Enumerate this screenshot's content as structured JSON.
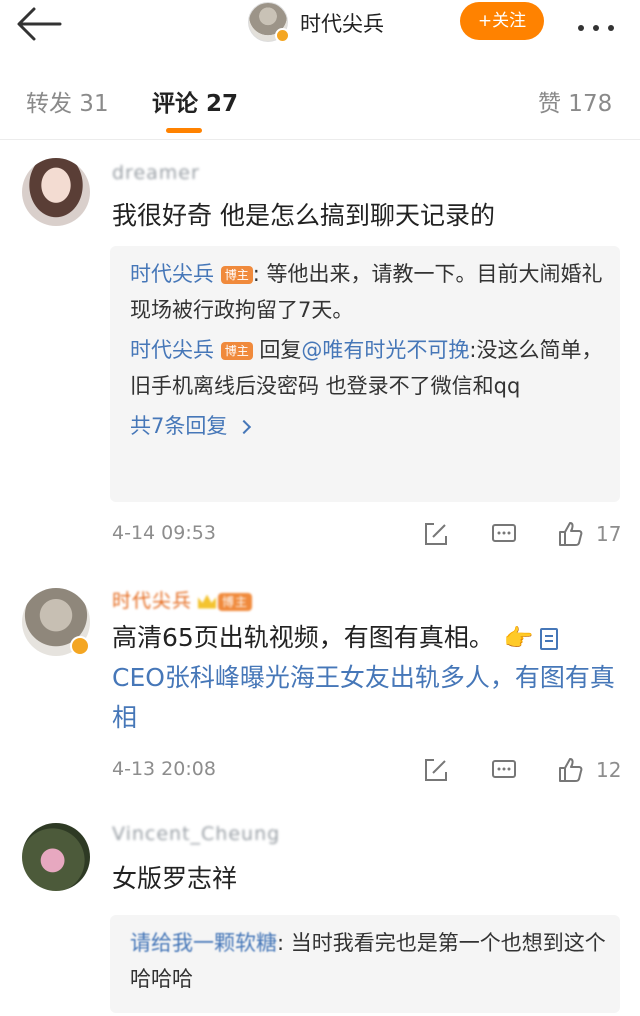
{
  "header": {
    "account_name": "时代尖兵",
    "follow_label": "+关注",
    "colors": {
      "accent": "#ff8200",
      "link": "#4677b8"
    }
  },
  "tabs": [
    {
      "label": "转发 31"
    },
    {
      "label": "评论 27"
    },
    {
      "label": "赞 178"
    }
  ],
  "comments": [
    {
      "user": "dreamer",
      "text": "我很好奇  他是怎么搞到聊天记录的",
      "replies": [
        {
          "name": "时代尖兵",
          "badge": "博主",
          "prefix": "",
          "mention": "",
          "text": ": 等他出来，请教一下。目前大闹婚礼现场被行政拘留了7天。"
        },
        {
          "name": "时代尖兵",
          "badge": "博主",
          "prefix": " 回复",
          "mention": "@唯有时光不可挽",
          "text": ":没这么简单，旧手机离线后没密码 也登录不了微信和qq"
        }
      ],
      "more_replies": "共7条回复",
      "time": "4-14 09:53",
      "likes": "17"
    },
    {
      "user": "时代尖兵",
      "badge": "博主",
      "text": "高清65页出轨视频，有图有真相。",
      "link_text": "CEO张科峰曝光海王女友出轨多人，有图有真相",
      "time": "4-13 20:08",
      "likes": "12"
    },
    {
      "user": "Vincent_Cheung",
      "text": "女版罗志祥",
      "replies": [
        {
          "name": "请给我一颗软糖",
          "text": ": 当时我看完也是第一个也想到这个哈哈哈"
        }
      ]
    }
  ]
}
